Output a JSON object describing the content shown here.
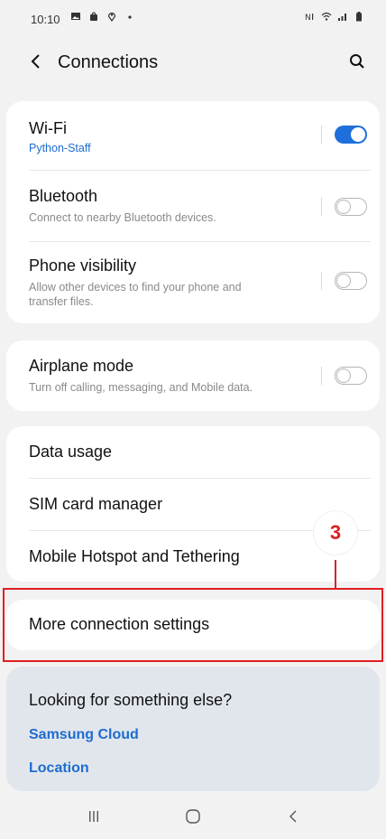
{
  "status_bar": {
    "time": "10:10",
    "left_icons": [
      "gallery-icon",
      "bag-icon",
      "location-icon",
      "dot-icon"
    ],
    "right_icons": [
      "mute-icon",
      "wifi-icon",
      "signal-icon",
      "battery-icon"
    ]
  },
  "header": {
    "title": "Connections",
    "back_icon": "back-icon",
    "search_icon": "search-icon"
  },
  "group1": {
    "items": [
      {
        "title": "Wi-Fi",
        "subtitle": "Python-Staff",
        "toggle": "on"
      },
      {
        "title": "Bluetooth",
        "subtitle": "Connect to nearby Bluetooth devices.",
        "toggle": "off"
      },
      {
        "title": "Phone visibility",
        "subtitle_line1": "Allow other devices to find your phone and",
        "subtitle_line2": "transfer files.",
        "toggle": "off"
      }
    ]
  },
  "group2": {
    "items": [
      {
        "title": "Airplane mode",
        "subtitle": "Turn off calling, messaging, and Mobile data.",
        "toggle": "off"
      }
    ]
  },
  "group3": {
    "items": [
      {
        "title": "Data usage"
      },
      {
        "title": "SIM card manager"
      },
      {
        "title": "Mobile Hotspot and Tethering"
      }
    ]
  },
  "group4": {
    "items": [
      {
        "title": "More connection settings"
      }
    ]
  },
  "annotation": {
    "number": "3"
  },
  "suggestions": {
    "title": "Looking for something else?",
    "links": [
      "Samsung Cloud",
      "Location"
    ]
  },
  "nav_bar": {
    "icons": [
      "recent-apps-icon",
      "home-icon",
      "back-nav-icon"
    ]
  },
  "colors": {
    "accent_blue": "#1e6fdb",
    "link_blue": "#1d6ccf",
    "highlight_red": "#e01e24",
    "background": "#f2f2f2",
    "suggestion_bg": "#e1e6ed"
  }
}
